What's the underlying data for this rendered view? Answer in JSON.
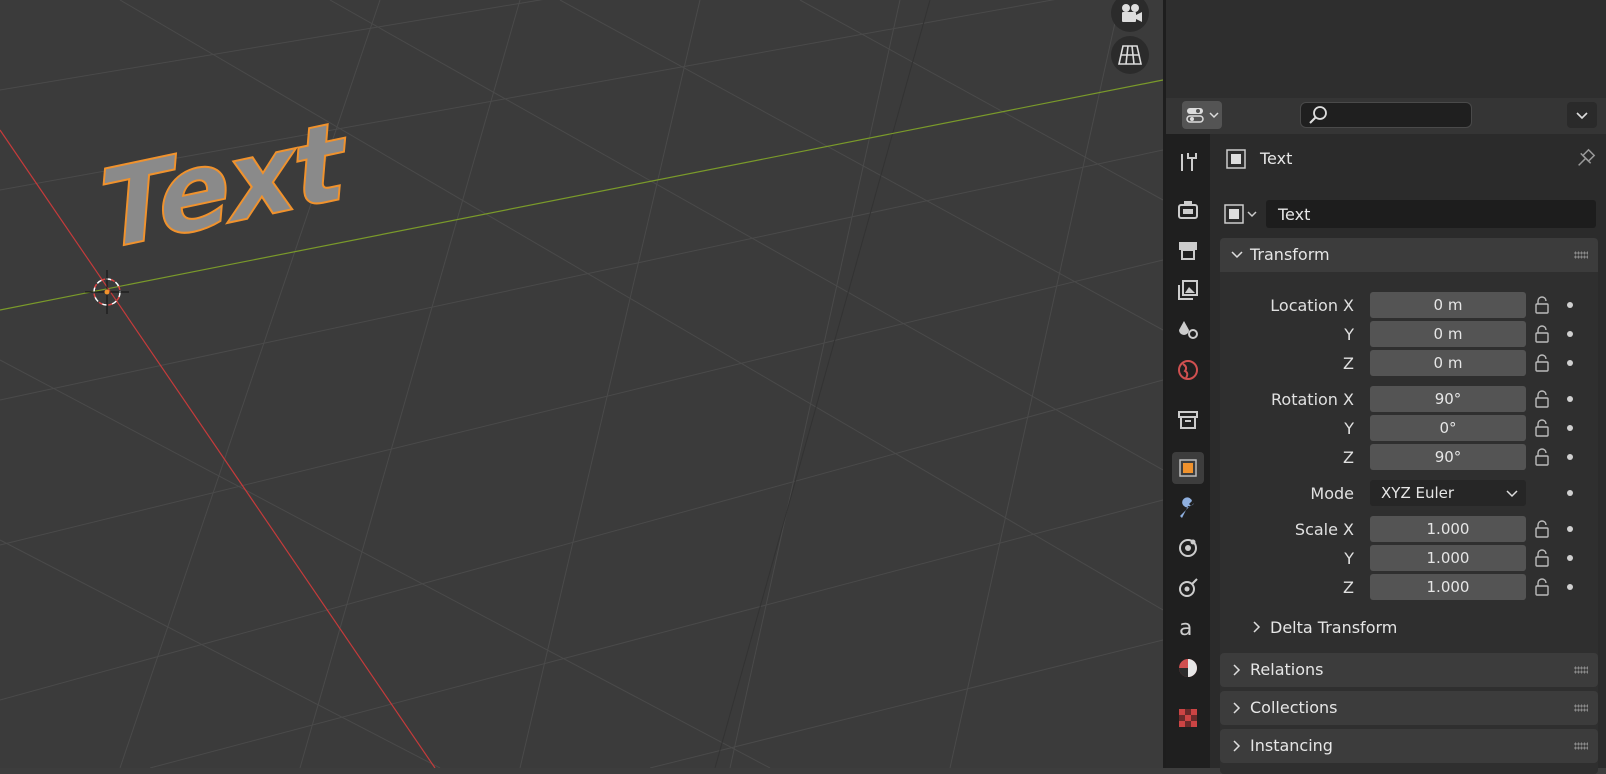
{
  "viewport": {
    "object_text": "Text",
    "buttons": [
      {
        "name": "camera-view-icon"
      },
      {
        "name": "perspective-grid-icon"
      }
    ]
  },
  "properties": {
    "header": {
      "search_placeholder": ""
    },
    "tabs": [
      {
        "name": "tool-tab",
        "icon": "wrench-screwdriver-icon"
      },
      {
        "name": "render-tab",
        "icon": "camera-back-icon"
      },
      {
        "name": "output-tab",
        "icon": "printer-icon"
      },
      {
        "name": "view-layer-tab",
        "icon": "image-stack-icon"
      },
      {
        "name": "scene-tab",
        "icon": "scene-icon"
      },
      {
        "name": "world-tab",
        "icon": "globe-icon"
      },
      {
        "name": "collection-tab",
        "icon": "box-icon"
      },
      {
        "name": "object-tab",
        "icon": "object-square-icon",
        "active": true
      },
      {
        "name": "modifiers-tab",
        "icon": "wrench-icon"
      },
      {
        "name": "physics-tab",
        "icon": "orbit-icon"
      },
      {
        "name": "constraints-tab",
        "icon": "constraint-icon"
      },
      {
        "name": "data-tab",
        "icon": "font-a-icon"
      },
      {
        "name": "material-tab",
        "icon": "material-sphere-icon"
      },
      {
        "name": "texture-tab",
        "icon": "checker-icon"
      }
    ],
    "context_title": "Text",
    "object_name": "Text",
    "transform": {
      "title": "Transform",
      "location": {
        "label_x": "Location X",
        "label_y": "Y",
        "label_z": "Z",
        "x": "0 m",
        "y": "0 m",
        "z": "0 m"
      },
      "rotation": {
        "label_x": "Rotation X",
        "label_y": "Y",
        "label_z": "Z",
        "x": "90°",
        "y": "0°",
        "z": "90°"
      },
      "mode": {
        "label": "Mode",
        "value": "XYZ Euler"
      },
      "scale": {
        "label_x": "Scale X",
        "label_y": "Y",
        "label_z": "Z",
        "x": "1.000",
        "y": "1.000",
        "z": "1.000"
      },
      "delta": "Delta Transform"
    },
    "sections": [
      "Relations",
      "Collections",
      "Instancing"
    ]
  },
  "colors": {
    "selection": "#f0922d",
    "x_axis": "#c43b3b",
    "y_axis": "#7a9a2a"
  }
}
